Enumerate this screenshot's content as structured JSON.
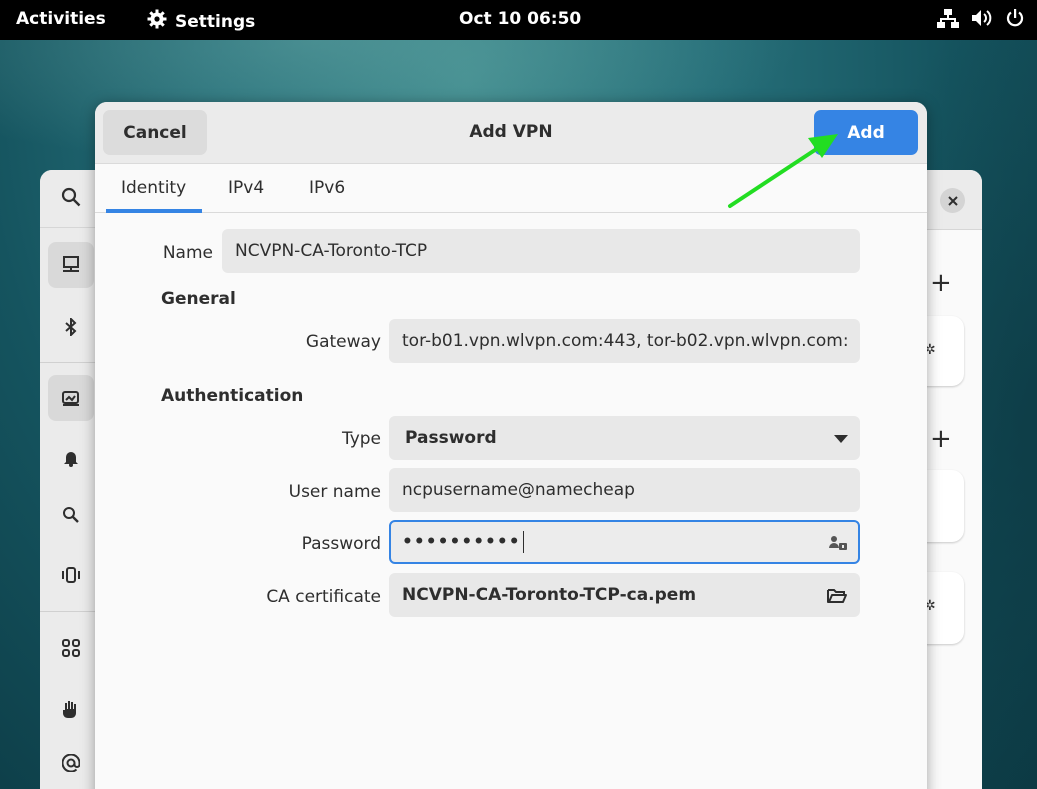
{
  "topbar": {
    "activities": "Activities",
    "app_name": "Settings",
    "clock": "Oct 10  06:50"
  },
  "dialog": {
    "title": "Add VPN",
    "cancel_label": "Cancel",
    "add_label": "Add",
    "tabs": [
      {
        "label": "Identity",
        "selected": true
      },
      {
        "label": "IPv4",
        "selected": false
      },
      {
        "label": "IPv6",
        "selected": false
      }
    ],
    "name_label": "Name",
    "name_value": "NCVPN-CA-Toronto-TCP",
    "general_heading": "General",
    "gateway_label": "Gateway",
    "gateway_value": "tor-b01.vpn.wlvpn.com:443, tor-b02.vpn.wlvpn.com:",
    "auth_heading": "Authentication",
    "type_label": "Type",
    "type_value": "Password",
    "username_label": "User name",
    "username_value": "ncpusername@namecheap",
    "password_label": "Password",
    "password_value": "••••••••••",
    "ca_label": "CA certificate",
    "ca_value": "NCVPN-CA-Toronto-TCP-ca.pem"
  },
  "colors": {
    "accent": "#3584e4",
    "annotation_arrow": "#22dd22"
  },
  "icons": {
    "app_menu": "gear-icon",
    "tray": [
      "network-wired-icon",
      "volume-icon",
      "power-icon"
    ],
    "type_dropdown": "chevron-down-icon",
    "password_storage": "user-key-icon",
    "ca_chooser": "folder-open-icon"
  }
}
